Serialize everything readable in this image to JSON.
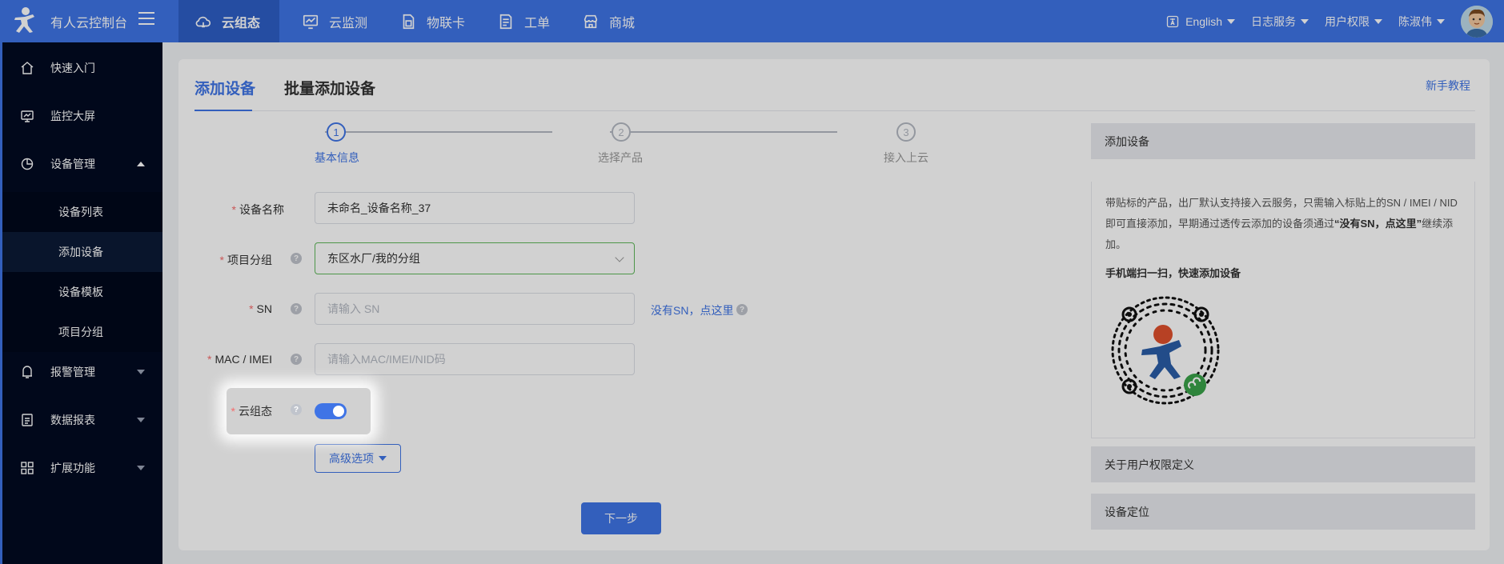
{
  "app": {
    "title": "有人云控制台"
  },
  "nav": [
    {
      "label": "云组态",
      "icon": "cloud-icon",
      "active": true
    },
    {
      "label": "云监测",
      "icon": "monitor-chart-icon",
      "active": false
    },
    {
      "label": "物联卡",
      "icon": "sim-card-icon",
      "active": false
    },
    {
      "label": "工单",
      "icon": "ticket-icon",
      "active": false
    },
    {
      "label": "商城",
      "icon": "store-icon",
      "active": false
    }
  ],
  "right_menu": {
    "language": "English",
    "logs": "日志服务",
    "permissions": "用户权限",
    "user": "陈淑伟"
  },
  "sidebar": {
    "items": [
      {
        "label": "快速入门",
        "icon": "home-icon"
      },
      {
        "label": "监控大屏",
        "icon": "screen-icon"
      },
      {
        "label": "设备管理",
        "icon": "pie-icon"
      },
      {
        "label": "报警管理",
        "icon": "bell-icon"
      },
      {
        "label": "数据报表",
        "icon": "report-icon"
      },
      {
        "label": "扩展功能",
        "icon": "grid-icon"
      }
    ],
    "sub_items": [
      {
        "label": "设备列表",
        "active": false
      },
      {
        "label": "添加设备",
        "active": true
      },
      {
        "label": "设备模板",
        "active": false
      },
      {
        "label": "项目分组",
        "active": false
      }
    ]
  },
  "tabs": {
    "add_device": "添加设备",
    "batch_add": "批量添加设备",
    "tutorial": "新手教程"
  },
  "steps": [
    {
      "num": "1",
      "label": "基本信息",
      "active": true
    },
    {
      "num": "2",
      "label": "选择产品",
      "active": false
    },
    {
      "num": "3",
      "label": "接入上云",
      "active": false
    }
  ],
  "form": {
    "required_mark": "*",
    "device_name": {
      "label": "设备名称",
      "value": "未命名_设备名称_37"
    },
    "project_group": {
      "label": "项目分组",
      "value": "东区水厂/我的分组"
    },
    "sn": {
      "label": "SN",
      "placeholder": "请输入 SN",
      "link": "没有SN，点这里"
    },
    "mac": {
      "label": "MAC / IMEI",
      "placeholder": "请输入MAC/IMEI/NID码"
    },
    "cloud_config": {
      "label": "云组态",
      "enabled": true
    },
    "help_mark": "?",
    "advanced": "高级选项",
    "next": "下一步"
  },
  "panel": {
    "add_device_title": "添加设备",
    "desc_1": "带贴标的产品，出厂默认支持接入云服务，只需输入标贴上的SN / IMEI / NID 即可直接添加，早期通过透传云添加的设备须通过",
    "desc_bold": "“没有SN，点这里”",
    "desc_2": "继续添加。",
    "scan_title": "手机端扫一扫，快速添加设备",
    "permissions_title": "关于用户权限定义",
    "location_title": "设备定位"
  },
  "colors": {
    "primary": "#3f74e6",
    "sidebar": "#020a22",
    "required": "#f56c6c"
  }
}
